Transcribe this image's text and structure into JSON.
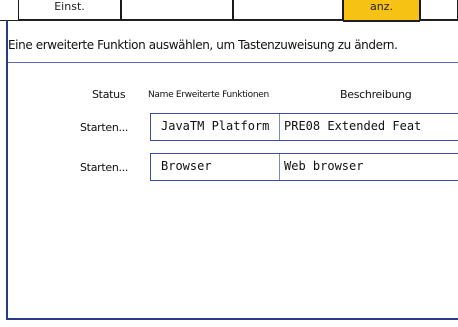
{
  "tabs": [
    {
      "label": "Einst.",
      "active": false
    },
    {
      "label": "",
      "active": false
    },
    {
      "label": "",
      "active": false
    },
    {
      "label": "anz.",
      "active": true
    },
    {
      "label": "",
      "active": false
    }
  ],
  "instruction": "Eine erweiterte Funktion auswählen, um Tastenzuweisung zu ändern.",
  "columns": {
    "status": "Status",
    "name": "Name Erweiterte Funktionen",
    "description": "Beschreibung"
  },
  "rows": [
    {
      "status": "Starten...",
      "name": "JavaTM Platform",
      "description": "PRE08 Extended Feat"
    },
    {
      "status": "Starten...",
      "name": "Browser",
      "description": "Web browser"
    }
  ],
  "colors": {
    "active_tab": "#f6c315",
    "frame": "#2a3a8a",
    "row_border": "#3b4da0"
  }
}
